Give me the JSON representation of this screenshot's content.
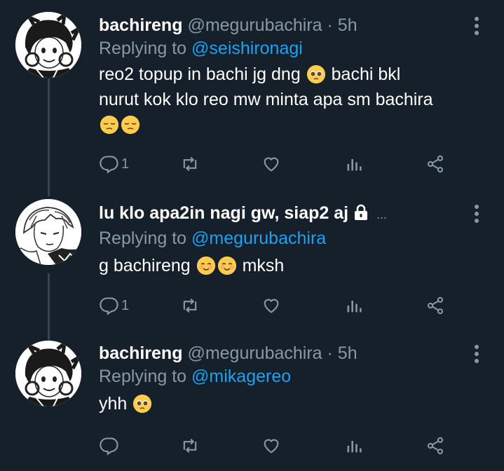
{
  "tweets": [
    {
      "display_name": "bachireng",
      "handle": "@megurubachira",
      "time": "· 5h",
      "replying_label": "Replying to",
      "replying_to": "@seishironagi",
      "text_line1": "reo2 topup in bachi jg dng",
      "text_line1b": "bachi bkl",
      "text_line2": "nurut kok klo reo mw minta apa sm bachira",
      "emojis": [
        "pleading-face",
        "pensive-face",
        "pensive-face"
      ],
      "reply_count": "1",
      "avatar": "bachira-avatar"
    },
    {
      "display_name": "lu klo apa2in nagi gw, siap2 aj",
      "ellipsis": "...",
      "protected_icon": "lock-icon",
      "replying_label": "Replying to",
      "replying_to": "@megurubachira",
      "text_part1": "g bachireng",
      "text_part2": "mksh",
      "emojis": [
        "smiling-face",
        "smiling-face"
      ],
      "reply_count": "1",
      "avatar": "reo-avatar"
    },
    {
      "display_name": "bachireng",
      "handle": "@megurubachira",
      "time": "· 5h",
      "replying_label": "Replying to",
      "replying_to": "@mikagereo",
      "text": "yhh",
      "emojis": [
        "pleading-face"
      ],
      "reply_count": "",
      "avatar": "bachira-avatar"
    }
  ],
  "icons": {
    "reply": "reply-icon",
    "retweet": "retweet-icon",
    "like": "heart-icon",
    "analytics": "analytics-icon",
    "share": "share-icon",
    "more": "more-options-icon"
  },
  "colors": {
    "background": "#15202b",
    "muted": "#8899a6",
    "mention": "#1da1f2",
    "thread_line": "#38444d"
  }
}
